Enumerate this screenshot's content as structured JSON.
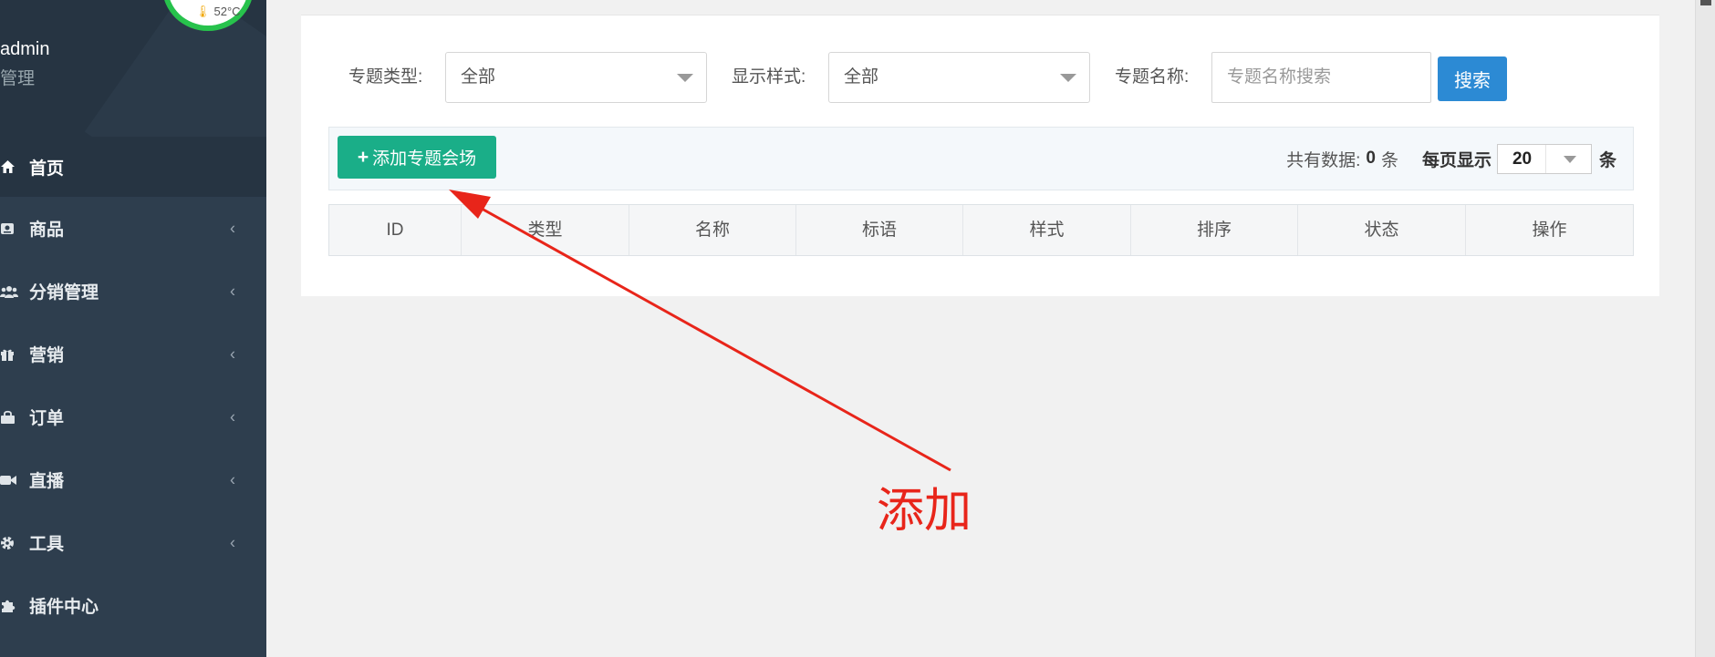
{
  "sidebar": {
    "temperature": "52°C",
    "username": "admin",
    "role": "管理",
    "items": [
      {
        "label": "首页",
        "icon": "home-icon",
        "arrow": ""
      },
      {
        "label": "商品",
        "icon": "product-icon",
        "arrow": "‹"
      },
      {
        "label": "分销管理",
        "icon": "users-icon",
        "arrow": "‹"
      },
      {
        "label": "营销",
        "icon": "gift-icon",
        "arrow": "‹"
      },
      {
        "label": "订单",
        "icon": "bag-icon",
        "arrow": "‹"
      },
      {
        "label": "直播",
        "icon": "video-icon",
        "arrow": "‹"
      },
      {
        "label": "工具",
        "icon": "gear-icon",
        "arrow": "‹"
      },
      {
        "label": "插件中心",
        "icon": "puzzle-icon",
        "arrow": ""
      }
    ]
  },
  "filters": {
    "type_label": "专题类型:",
    "type_value": "全部",
    "style_label": "显示样式:",
    "style_value": "全部",
    "name_label": "专题名称:",
    "name_placeholder": "专题名称搜索",
    "search_button": "搜索"
  },
  "toolbar": {
    "add_button": "添加专题会场",
    "total_label": "共有数据:",
    "total_count": "0",
    "total_unit": "条",
    "per_page_label": "每页显示",
    "per_page_value": "20",
    "per_page_unit": "条"
  },
  "table": {
    "columns": [
      "ID",
      "类型",
      "名称",
      "标语",
      "样式",
      "排序",
      "状态",
      "操作"
    ]
  },
  "annotation": {
    "text": "添加",
    "color": "#e8251a"
  },
  "colors": {
    "sidebar_bg": "#2e3e4e",
    "add_button": "#1aae88",
    "search_button": "#2c8ad4"
  }
}
